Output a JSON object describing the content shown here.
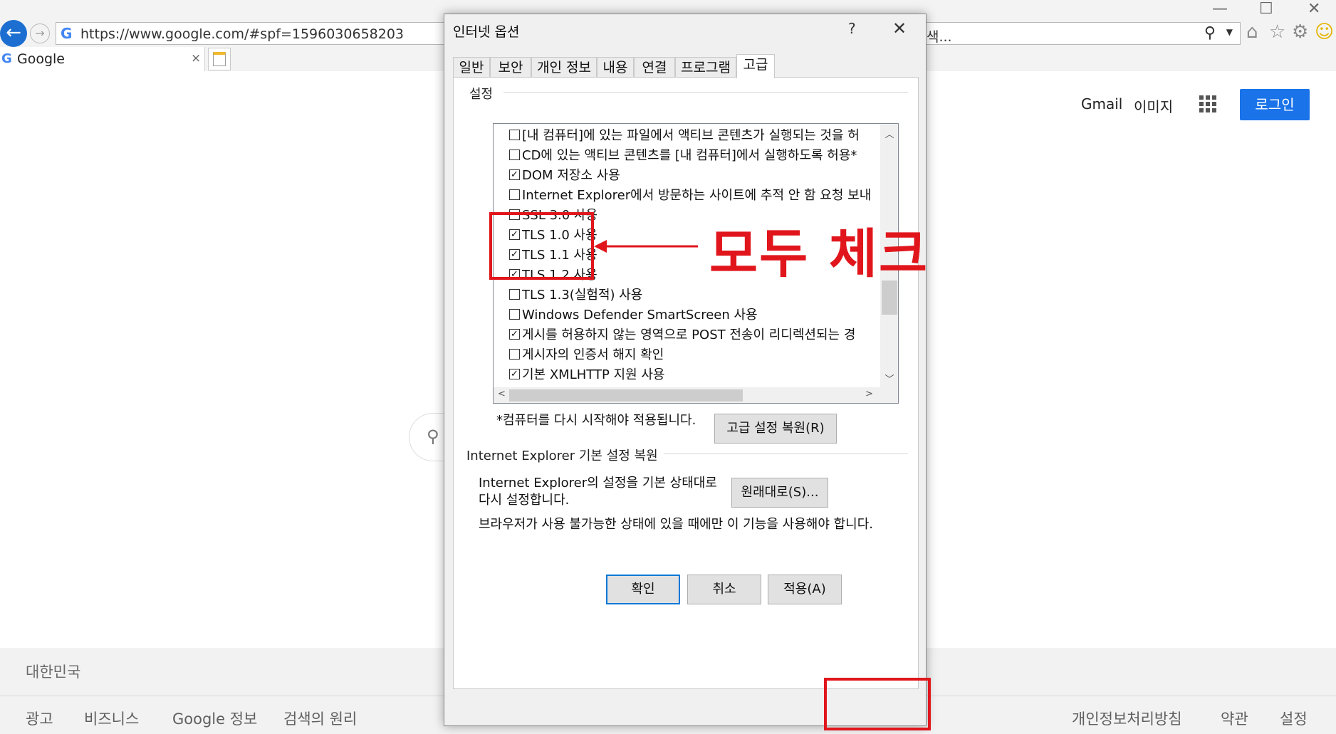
{
  "browser": {
    "url": "https://www.google.com/#spf=1596030658203",
    "address_fragment": "색...",
    "tab_title": "Google",
    "tab_close": "×"
  },
  "google": {
    "gmail": "Gmail",
    "images": "이미지",
    "login": "로그인",
    "country": "대한민국",
    "footer_left": [
      "광고",
      "비즈니스",
      "Google 정보",
      "검색의 원리"
    ],
    "footer_right": [
      "개인정보처리방침",
      "약관",
      "설정"
    ]
  },
  "dialog": {
    "title": "인터넷 옵션",
    "help": "?",
    "close": "✕",
    "tabs": [
      "일반",
      "보안",
      "개인 정보",
      "내용",
      "연결",
      "프로그램",
      "고급"
    ],
    "active_tab": "고급",
    "settings_label": "설정",
    "settings": [
      {
        "label": "[내 컴퓨터]에 있는 파일에서 액티브 콘텐츠가 실행되는 것을 허",
        "checked": false
      },
      {
        "label": "CD에 있는 액티브 콘텐츠를 [내 컴퓨터]에서 실행하도록 허용*",
        "checked": false
      },
      {
        "label": "DOM 저장소 사용",
        "checked": true
      },
      {
        "label": "Internet Explorer에서 방문하는 사이트에 추적 안 함 요청 보내",
        "checked": false
      },
      {
        "label": "SSL 3.0 사용",
        "checked": false
      },
      {
        "label": "TLS 1.0 사용",
        "checked": true
      },
      {
        "label": "TLS 1.1 사용",
        "checked": true
      },
      {
        "label": "TLS 1.2 사용",
        "checked": true
      },
      {
        "label": "TLS 1.3(실험적) 사용",
        "checked": false
      },
      {
        "label": "Windows Defender SmartScreen 사용",
        "checked": false
      },
      {
        "label": "게시를 허용하지 않는 영역으로 POST 전송이 리디렉션되는 경",
        "checked": true
      },
      {
        "label": "게시자의 인증서 해지 확인",
        "checked": false
      },
      {
        "label": "기본 XMLHTTP 지원 사용",
        "checked": true
      }
    ],
    "restart_note": "*컴퓨터를 다시 시작해야 적용됩니다.",
    "restore_advanced_button": "고급 설정 복원(R)",
    "ie_reset_label": "Internet Explorer 기본 설정 복원",
    "ie_reset_desc": "Internet Explorer의 설정을 기본 상태대로 다시 설정합니다.",
    "reset_button": "원래대로(S)...",
    "reset_warning": "브라우저가 사용 불가능한 상태에 있을 때에만 이 기능을 사용해야 합니다.",
    "ok_button": "확인",
    "cancel_button": "취소",
    "apply_button": "적용(A)"
  },
  "annotation": {
    "text": "모두 체크",
    "color": "#e0161c"
  },
  "colors": {
    "accent_blue": "#1a73e8",
    "focus_blue": "#0078d7"
  }
}
